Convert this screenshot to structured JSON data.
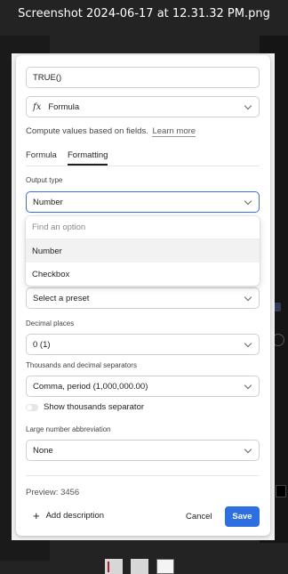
{
  "window": {
    "title": "Screenshot 2024-06-17 at 12.31.32 PM.png"
  },
  "field_name": {
    "value": "TRUE()"
  },
  "field_type": {
    "icon": "formula-fx-icon",
    "label": "Formula",
    "description": "Compute values based on fields.",
    "learn_more": "Learn more"
  },
  "tabs": [
    {
      "label": "Formula",
      "active": false
    },
    {
      "label": "Formatting",
      "active": true
    }
  ],
  "output_type": {
    "label": "Output type",
    "selected": "Number",
    "dropdown": {
      "search_placeholder": "Find an option",
      "options": [
        "Number",
        "Checkbox"
      ],
      "highlighted": "Number"
    }
  },
  "preset": {
    "value": "Select a preset"
  },
  "decimal_places": {
    "label": "Decimal places",
    "value": "0 (1)"
  },
  "separators": {
    "label": "Thousands and decimal separators",
    "value": "Comma, period (1,000,000.00)"
  },
  "show_thousands": {
    "label": "Show thousands separator",
    "enabled": false
  },
  "abbreviation": {
    "label": "Large number abbreviation",
    "value": "None"
  },
  "preview": {
    "text": "Preview: 3456"
  },
  "footer": {
    "add_description": "Add description",
    "cancel": "Cancel",
    "save": "Save"
  },
  "colors": {
    "accent": "#2d6fe0",
    "focus_border": "#3b6fd6",
    "viewer_background": "#232323"
  }
}
